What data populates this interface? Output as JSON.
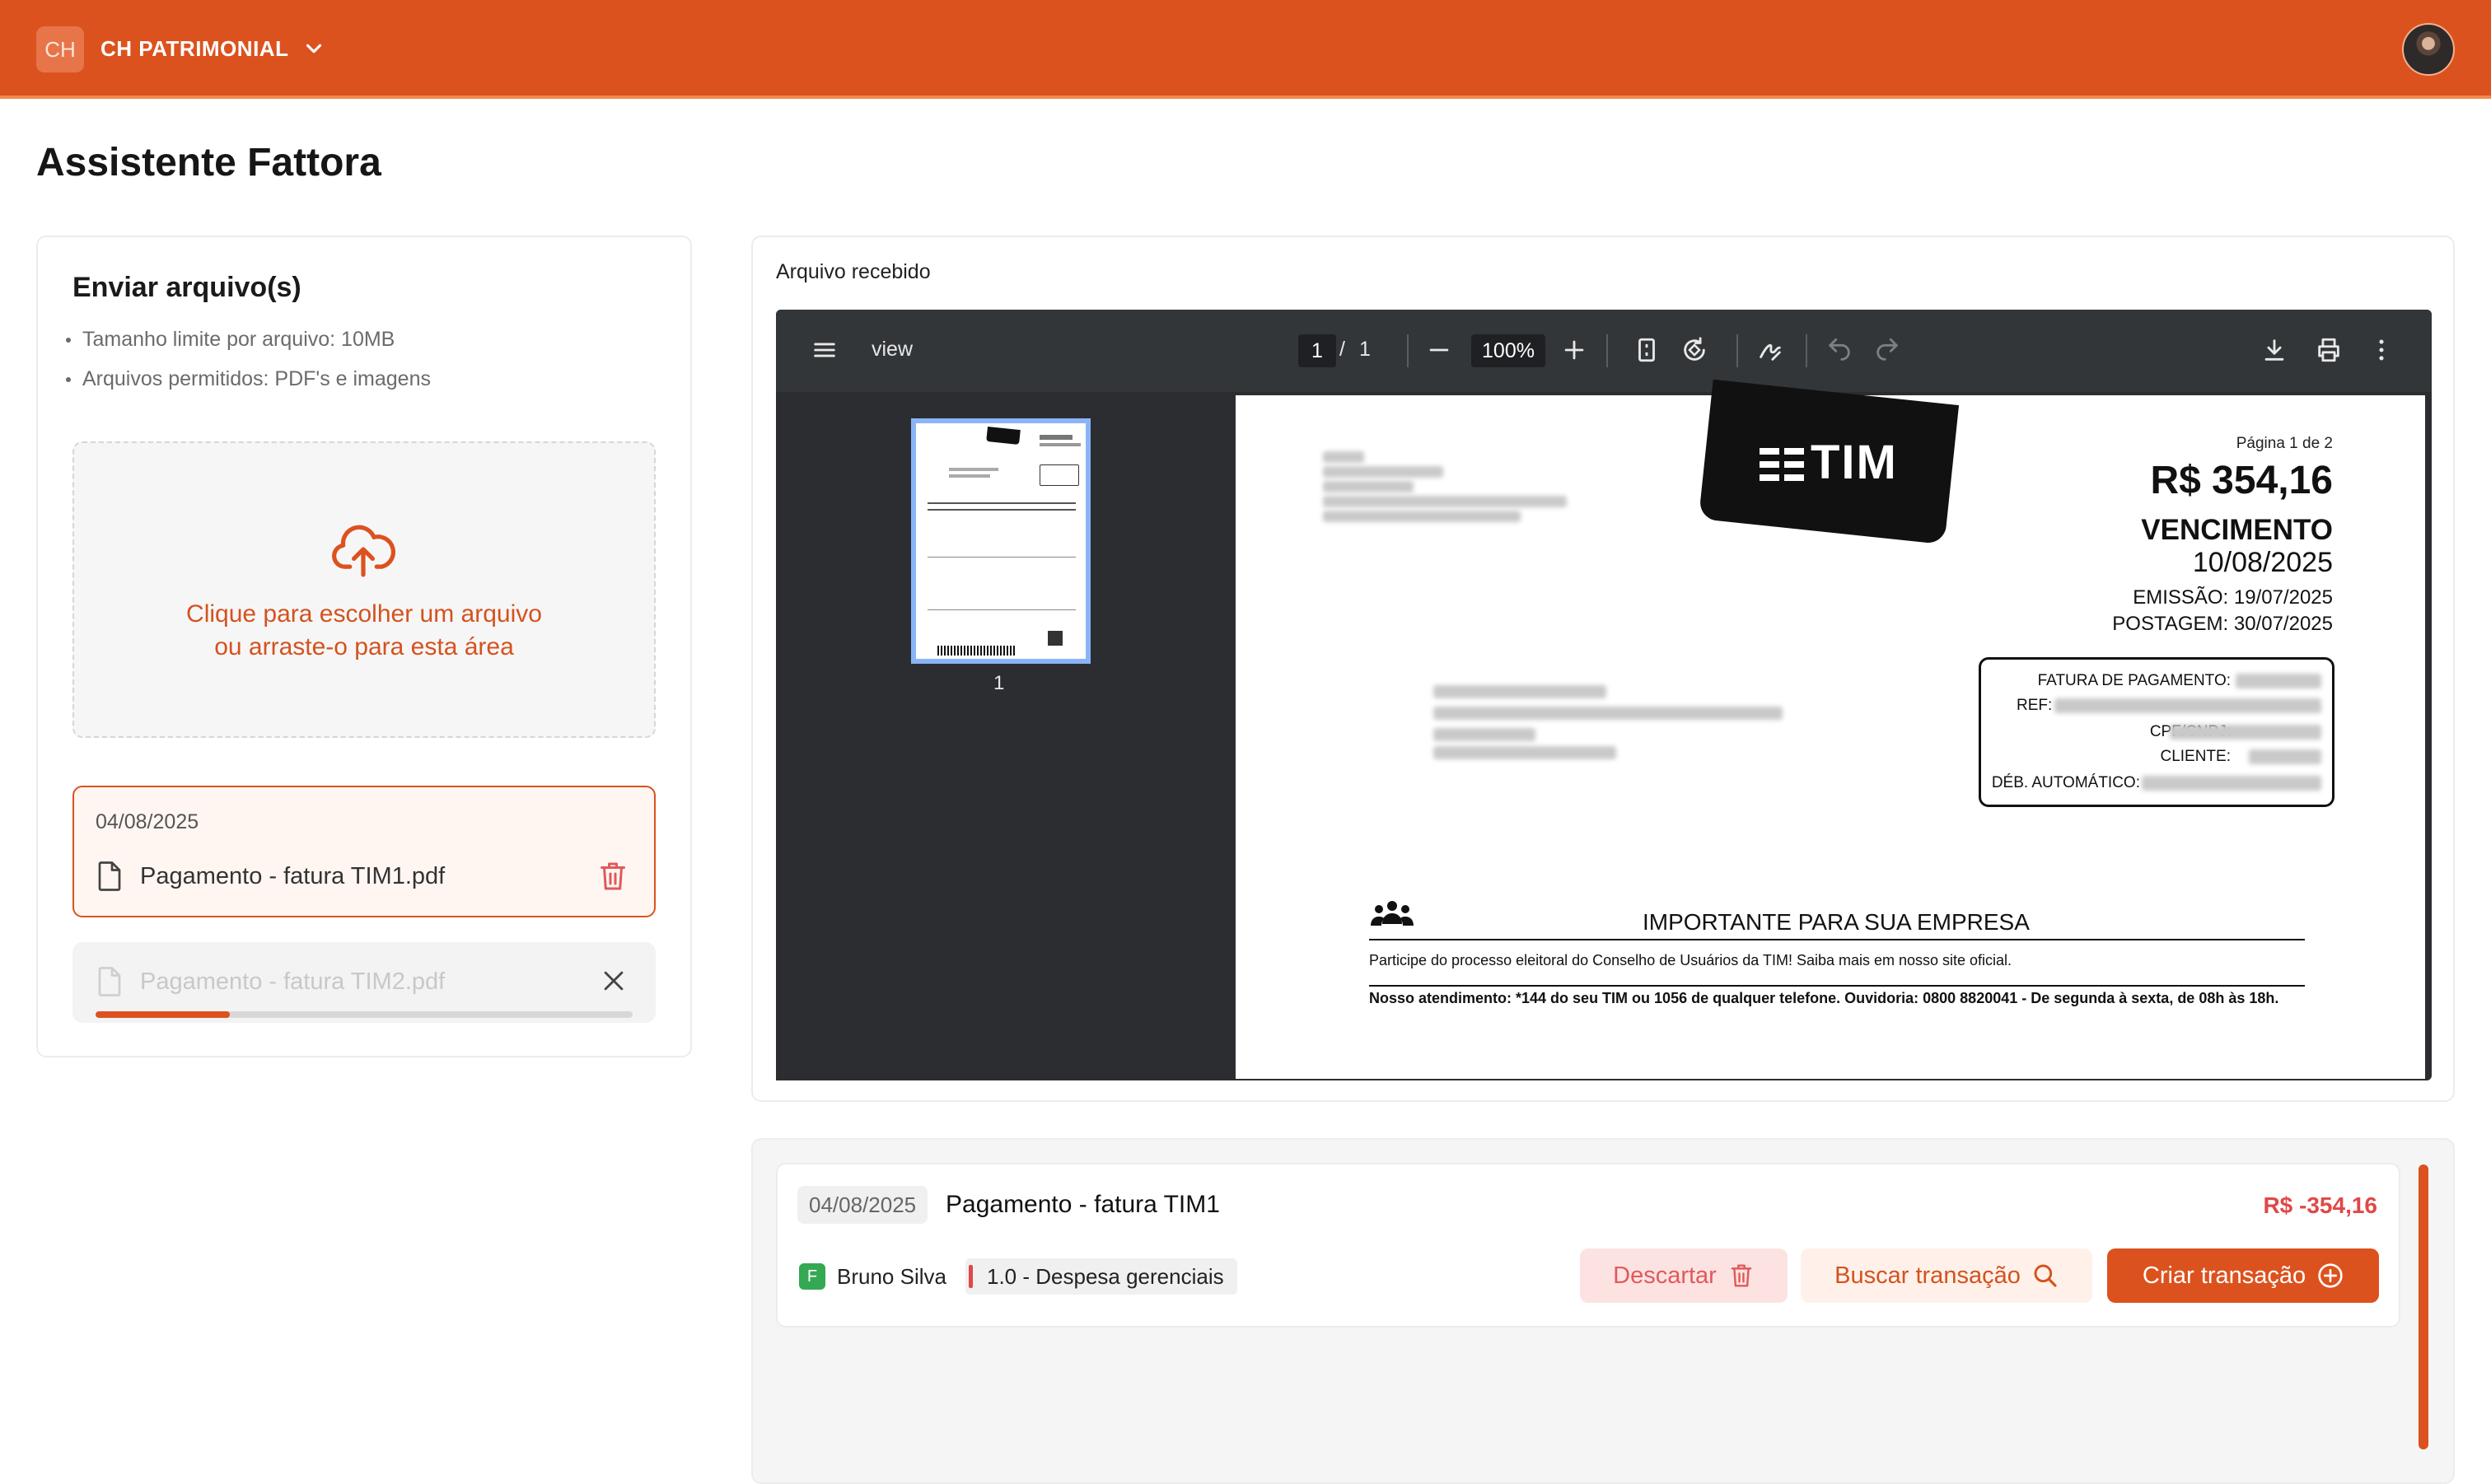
{
  "header": {
    "org_initials": "CH",
    "org_name": "CH PATRIMONIAL"
  },
  "page": {
    "title": "Assistente Fattora"
  },
  "upload": {
    "title": "Enviar arquivo(s)",
    "rules": [
      "Tamanho limite por arquivo: 10MB",
      "Arquivos permitidos: PDF's e imagens"
    ],
    "dropzone_line1": "Clique para escolher um arquivo",
    "dropzone_line2": "ou arraste-o para esta área",
    "files": [
      {
        "date": "04/08/2025",
        "name": "Pagamento - fatura TIM1.pdf",
        "status": "selected"
      },
      {
        "name": "Pagamento - fatura TIM2.pdf",
        "status": "uploading",
        "progress": 0.25
      }
    ]
  },
  "viewer": {
    "label": "Arquivo recebido",
    "doc_title": "view",
    "page_current": "1",
    "page_sep": "/",
    "page_total": "1",
    "zoom": "100%",
    "thumb_page": "1"
  },
  "document": {
    "brand": "TIM",
    "page_info": "Página 1 de 2",
    "amount": "R$ 354,16",
    "due_label": "VENCIMENTO",
    "due_date": "10/08/2025",
    "emission": "EMISSÃO: 19/07/2025",
    "posting": "POSTAGEM: 30/07/2025",
    "info_labels": [
      "FATURA DE PAGAMENTO:",
      "REF:",
      "CPF/CNPJ:",
      "CLIENTE:",
      "DÉB. AUTOMÁTICO:"
    ],
    "important_title": "IMPORTANTE PARA SUA EMPRESA",
    "important_text": "Participe do processo eleitoral do Conselho de Usuários da TIM! Saiba mais em nosso site oficial.",
    "service_text": "Nosso atendimento: *144 do seu TIM ou 1056 de qualquer telefone. Ouvidoria: 0800 8820041 - De segunda à sexta, de 08h às 18h."
  },
  "transaction": {
    "date": "04/08/2025",
    "title": "Pagamento - fatura TIM1",
    "amount": "R$ -354,16",
    "user_initial": "F",
    "user_name": "Bruno Silva",
    "category": "1.0 - Despesa gerenciais",
    "discard_label": "Descartar",
    "search_label": "Buscar transação",
    "create_label": "Criar transação"
  },
  "colors": {
    "brand": "#dc521e",
    "negative": "#e04848",
    "user_badge": "#34a853"
  }
}
